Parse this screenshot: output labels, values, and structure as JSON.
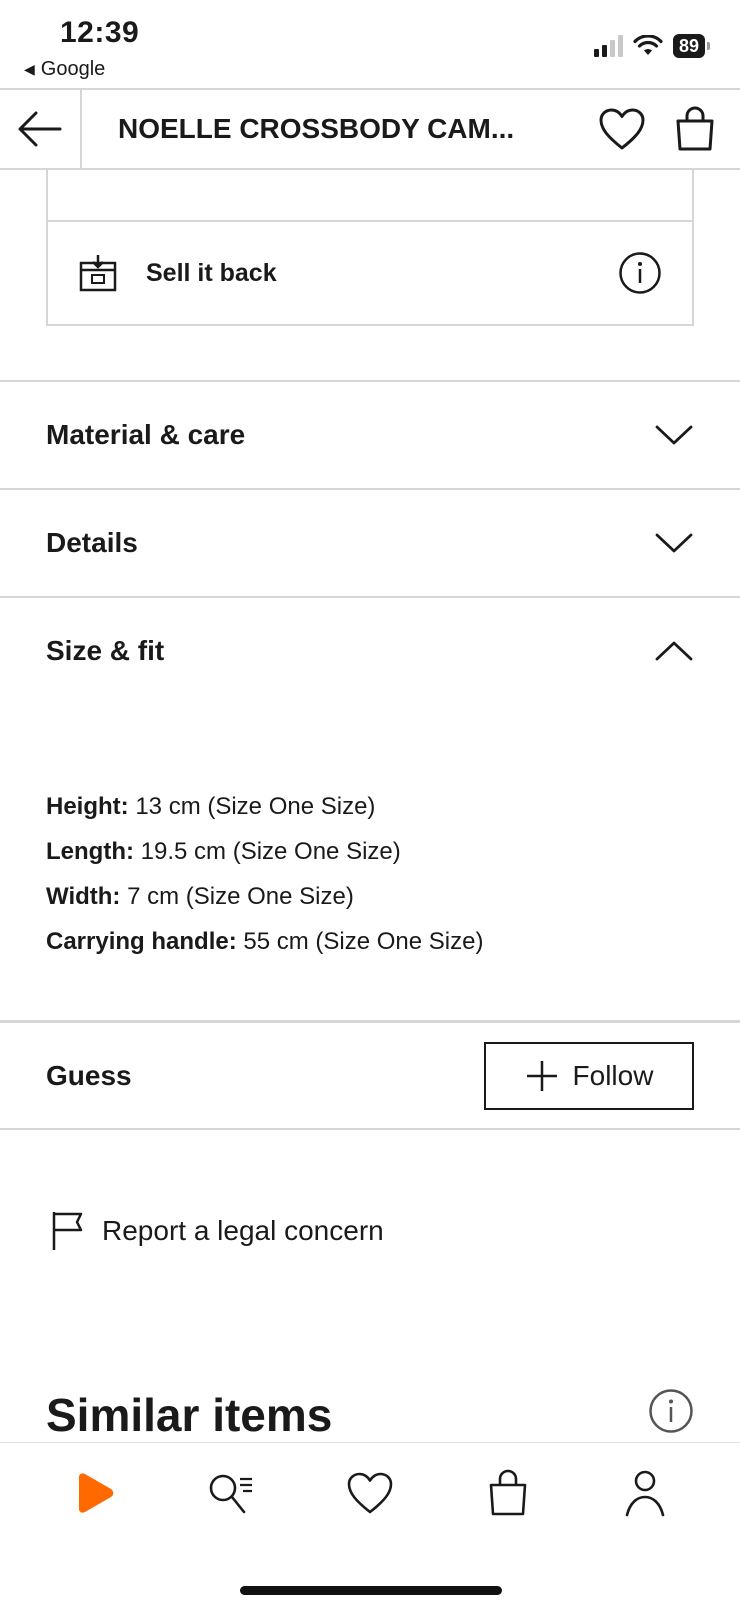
{
  "status_bar": {
    "time": "12:39",
    "back_app": "Google",
    "battery": "89"
  },
  "header": {
    "title": "NOELLE CROSSBODY CAM..."
  },
  "sell_back": {
    "label": "Sell it back"
  },
  "accordions": [
    {
      "label": "Material & care",
      "state": "collapsed"
    },
    {
      "label": "Details",
      "state": "collapsed"
    },
    {
      "label": "Size & fit",
      "state": "expanded"
    }
  ],
  "size_fit": [
    {
      "key": "Height:",
      "value": "13 cm (Size One Size)"
    },
    {
      "key": "Length:",
      "value": "19.5 cm (Size One Size)"
    },
    {
      "key": "Width:",
      "value": "7 cm (Size One Size)"
    },
    {
      "key": "Carrying handle:",
      "value": "55 cm (Size One Size)"
    }
  ],
  "brand": {
    "name": "Guess",
    "follow_label": "Follow"
  },
  "report": {
    "label": "Report a legal concern"
  },
  "similar": {
    "title": "Similar items"
  },
  "bottom_nav": {
    "accent": "#ff6900",
    "items": [
      "home-icon",
      "search-icon",
      "heart-icon",
      "bag-icon",
      "profile-icon"
    ]
  }
}
